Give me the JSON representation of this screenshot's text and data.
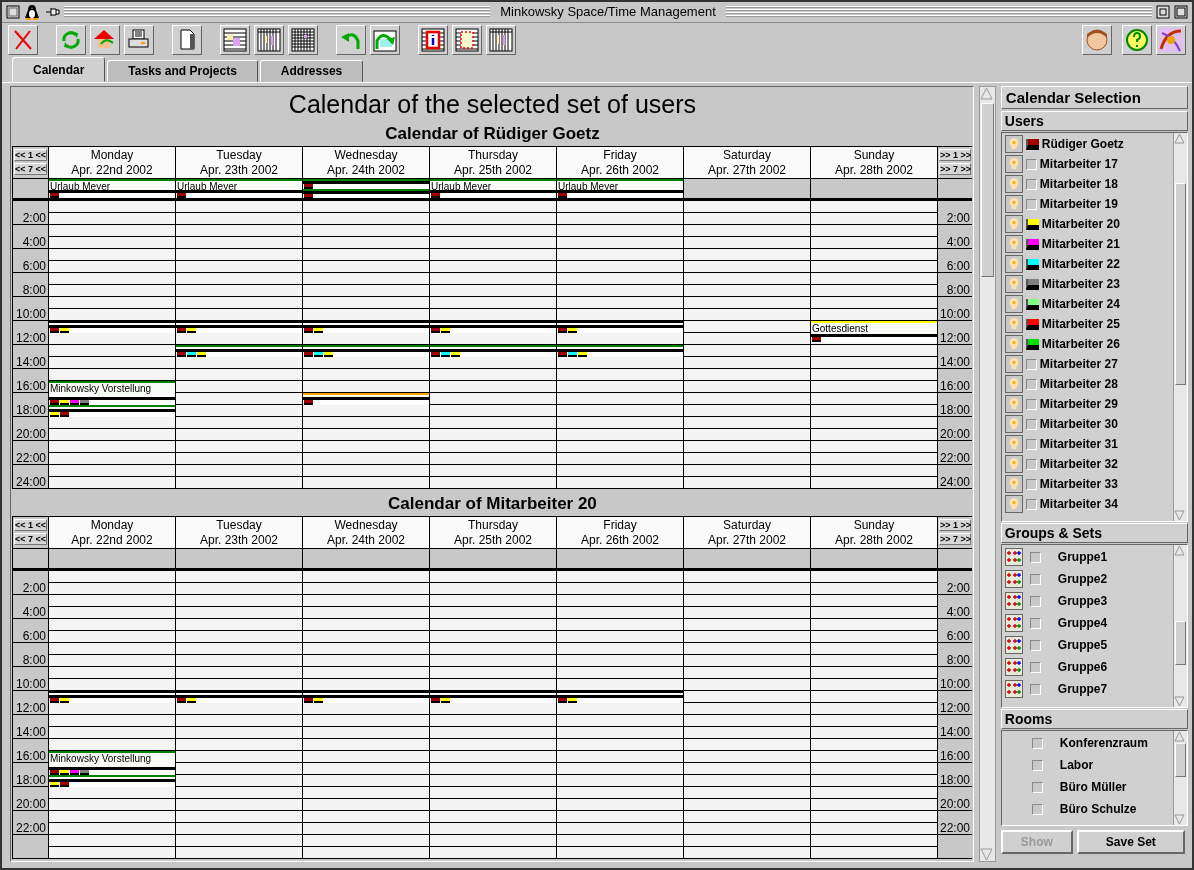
{
  "window": {
    "title": "Minkowsky Space/Time Management"
  },
  "tabs": [
    {
      "label": "Calendar",
      "selected": true
    },
    {
      "label": "Tasks and Projects",
      "selected": false
    },
    {
      "label": "Addresses",
      "selected": false
    }
  ],
  "calendar": {
    "heading": "Calendar of the selected set of users",
    "weeks": [
      {
        "title": "Calendar of Rüdiger Goetz",
        "nav_left": [
          "<< 1 <<",
          "<< 7 <<"
        ],
        "nav_right": [
          ">> 1 >>",
          ">> 7 >>"
        ],
        "times_left": [
          "2:00",
          "4:00",
          "6:00",
          "8:00",
          "10:00",
          "12:00",
          "14:00",
          "16:00",
          "18:00",
          "20:00",
          "22:00",
          "24:00"
        ],
        "times_right": [
          "2:00",
          "4:00",
          "6:00",
          "8:00",
          "10:00",
          "12:00",
          "14:00",
          "16:00",
          "18:00",
          "20:00",
          "22:00",
          "24:00"
        ],
        "days": [
          {
            "name": "Monday",
            "date": "Apr. 22nd 2002",
            "all_day": [
              {
                "title": "Urlaub Meyer",
                "color": "#008000",
                "marks": [
                  {
                    "color": "#a00000"
                  }
                ]
              }
            ],
            "slots": [
              {
                "kind": "gap"
              },
              {
                "kind": "gap"
              },
              {
                "kind": "gap"
              },
              {
                "kind": "gap"
              },
              {
                "kind": "gap"
              },
              {
                "kind": "gap"
              },
              {
                "kind": "gap"
              },
              {
                "kind": "gap"
              },
              {
                "kind": "gap"
              },
              {
                "kind": "gap"
              },
              {
                "kind": "hour",
                "color": "#000000",
                "marks": [
                  {
                    "color": "#a00000"
                  },
                  {
                    "color": "#ffff00"
                  }
                ]
              },
              {
                "kind": "gap"
              },
              {
                "kind": "gap"
              },
              {
                "kind": "gap"
              },
              {
                "kind": "gap"
              },
              {
                "kind": "two-hours",
                "title": "Minkowsky Vorstellung",
                "color": "#008000",
                "marks": [
                  {
                    "color": "#a00000"
                  },
                  {
                    "color": "#ffff00"
                  },
                  {
                    "color": "#ff00ff"
                  },
                  {
                    "color": "#808080"
                  }
                ]
              },
              {
                "kind": "hour",
                "color": "#008000",
                "marks": [
                  {
                    "color": "#ffff00"
                  },
                  {
                    "color": "#a00000"
                  }
                ]
              }
            ]
          },
          {
            "name": "Tuesday",
            "date": "Apr. 23th 2002",
            "all_day": [
              {
                "title": "Urlaub Meyer",
                "color": "#008000",
                "marks": [
                  {
                    "color": "#a00000"
                  }
                ]
              }
            ],
            "slots": [
              {
                "kind": "gap"
              },
              {
                "kind": "gap"
              },
              {
                "kind": "gap"
              },
              {
                "kind": "gap"
              },
              {
                "kind": "gap"
              },
              {
                "kind": "gap"
              },
              {
                "kind": "gap"
              },
              {
                "kind": "gap"
              },
              {
                "kind": "gap"
              },
              {
                "kind": "gap"
              },
              {
                "kind": "hour",
                "color": "#000000",
                "marks": [
                  {
                    "color": "#a00000"
                  },
                  {
                    "color": "#ffff00"
                  }
                ]
              },
              {
                "kind": "gap"
              },
              {
                "kind": "hour",
                "color": "#008000",
                "marks": [
                  {
                    "color": "#a00000"
                  },
                  {
                    "color": "#00ffff"
                  },
                  {
                    "color": "#ffff00"
                  }
                ]
              }
            ]
          },
          {
            "name": "Wednesday",
            "date": "Apr. 24th 2002",
            "all_day": [
              {
                "color": "#008000",
                "marks": [
                  {
                    "color": "#a00000"
                  }
                ]
              },
              {
                "color": "#008000",
                "marks": [
                  {
                    "color": "#a00000"
                  }
                ]
              }
            ],
            "slots": [
              {
                "kind": "gap"
              },
              {
                "kind": "gap"
              },
              {
                "kind": "gap"
              },
              {
                "kind": "gap"
              },
              {
                "kind": "gap"
              },
              {
                "kind": "gap"
              },
              {
                "kind": "gap"
              },
              {
                "kind": "gap"
              },
              {
                "kind": "gap"
              },
              {
                "kind": "gap"
              },
              {
                "kind": "hour",
                "color": "#000000",
                "marks": [
                  {
                    "color": "#a00000"
                  },
                  {
                    "color": "#ffff00"
                  }
                ]
              },
              {
                "kind": "gap"
              },
              {
                "kind": "hour",
                "color": "#008000",
                "marks": [
                  {
                    "color": "#a00000"
                  },
                  {
                    "color": "#00ffff"
                  },
                  {
                    "color": "#ffff00"
                  }
                ]
              },
              {
                "kind": "gap"
              },
              {
                "kind": "gap"
              },
              {
                "kind": "gap"
              },
              {
                "kind": "hour",
                "color": "#ffa500",
                "marks": [
                  {
                    "color": "#a00000"
                  }
                ]
              }
            ]
          },
          {
            "name": "Thursday",
            "date": "Apr. 25th 2002",
            "all_day": [
              {
                "title": "Urlaub Meyer",
                "color": "#008000",
                "marks": [
                  {
                    "color": "#a00000"
                  }
                ]
              }
            ],
            "slots": [
              {
                "kind": "gap"
              },
              {
                "kind": "gap"
              },
              {
                "kind": "gap"
              },
              {
                "kind": "gap"
              },
              {
                "kind": "gap"
              },
              {
                "kind": "gap"
              },
              {
                "kind": "gap"
              },
              {
                "kind": "gap"
              },
              {
                "kind": "gap"
              },
              {
                "kind": "gap"
              },
              {
                "kind": "hour",
                "color": "#000000",
                "marks": [
                  {
                    "color": "#a00000"
                  },
                  {
                    "color": "#ffff00"
                  }
                ]
              },
              {
                "kind": "gap"
              },
              {
                "kind": "hour",
                "color": "#008000",
                "marks": [
                  {
                    "color": "#a00000"
                  },
                  {
                    "color": "#00ffff"
                  },
                  {
                    "color": "#ffff00"
                  }
                ]
              }
            ]
          },
          {
            "name": "Friday",
            "date": "Apr. 26th 2002",
            "all_day": [
              {
                "title": "Urlaub Meyer",
                "color": "#008000",
                "marks": [
                  {
                    "color": "#a00000"
                  }
                ]
              }
            ],
            "slots": [
              {
                "kind": "gap"
              },
              {
                "kind": "gap"
              },
              {
                "kind": "gap"
              },
              {
                "kind": "gap"
              },
              {
                "kind": "gap"
              },
              {
                "kind": "gap"
              },
              {
                "kind": "gap"
              },
              {
                "kind": "gap"
              },
              {
                "kind": "gap"
              },
              {
                "kind": "gap"
              },
              {
                "kind": "hour",
                "color": "#000000",
                "marks": [
                  {
                    "color": "#a00000"
                  },
                  {
                    "color": "#ffff00"
                  }
                ]
              },
              {
                "kind": "gap"
              },
              {
                "kind": "hour",
                "color": "#008000",
                "marks": [
                  {
                    "color": "#a00000"
                  },
                  {
                    "color": "#00ffff"
                  },
                  {
                    "color": "#ffff00"
                  }
                ]
              }
            ]
          },
          {
            "name": "Saturday",
            "date": "Apr. 27th 2002"
          },
          {
            "name": "Sunday",
            "date": "Apr. 28th 2002",
            "slots": [
              {
                "kind": "gap"
              },
              {
                "kind": "gap"
              },
              {
                "kind": "gap"
              },
              {
                "kind": "gap"
              },
              {
                "kind": "gap"
              },
              {
                "kind": "gap"
              },
              {
                "kind": "gap"
              },
              {
                "kind": "gap"
              },
              {
                "kind": "gap"
              },
              {
                "kind": "gap"
              },
              {
                "kind": "hour-half",
                "title": "Gottesdienst",
                "color": "#ffff00",
                "marks": [
                  {
                    "color": "#a00000"
                  }
                ]
              }
            ]
          }
        ]
      },
      {
        "title": "Calendar of Mitarbeiter 20",
        "nav_left": [
          "<< 1 <<",
          "<< 7 <<"
        ],
        "nav_right": [
          ">> 1 >>",
          ">> 7 >>"
        ],
        "times_left": [
          "2:00",
          "4:00",
          "6:00",
          "8:00",
          "10:00",
          "12:00",
          "14:00",
          "16:00",
          "18:00",
          "20:00",
          "22:00"
        ],
        "times_right": [
          "2:00",
          "4:00",
          "6:00",
          "8:00",
          "10:00",
          "12:00",
          "14:00",
          "16:00",
          "18:00",
          "20:00",
          "22:00"
        ],
        "days": [
          {
            "name": "Monday",
            "date": "Apr. 22nd 2002",
            "slots": [
              {
                "kind": "gap"
              },
              {
                "kind": "gap"
              },
              {
                "kind": "gap"
              },
              {
                "kind": "gap"
              },
              {
                "kind": "gap"
              },
              {
                "kind": "gap"
              },
              {
                "kind": "gap"
              },
              {
                "kind": "gap"
              },
              {
                "kind": "gap"
              },
              {
                "kind": "gap"
              },
              {
                "kind": "hour",
                "color": "#000000",
                "marks": [
                  {
                    "color": "#a00000"
                  },
                  {
                    "color": "#ffff00"
                  }
                ]
              },
              {
                "kind": "gap"
              },
              {
                "kind": "gap"
              },
              {
                "kind": "gap"
              },
              {
                "kind": "gap"
              },
              {
                "kind": "two-hours",
                "title": "Minkowsky Vorstellung",
                "color": "#008000",
                "marks": [
                  {
                    "color": "#a00000"
                  },
                  {
                    "color": "#ffff00"
                  },
                  {
                    "color": "#ff00ff"
                  },
                  {
                    "color": "#808080"
                  }
                ]
              },
              {
                "kind": "hour",
                "color": "#008000",
                "marks": [
                  {
                    "color": "#ffff00"
                  },
                  {
                    "color": "#a00000"
                  }
                ]
              }
            ]
          },
          {
            "name": "Tuesday",
            "date": "Apr. 23th 2002",
            "slots": [
              {
                "kind": "gap"
              },
              {
                "kind": "gap"
              },
              {
                "kind": "gap"
              },
              {
                "kind": "gap"
              },
              {
                "kind": "gap"
              },
              {
                "kind": "gap"
              },
              {
                "kind": "gap"
              },
              {
                "kind": "gap"
              },
              {
                "kind": "gap"
              },
              {
                "kind": "gap"
              },
              {
                "kind": "hour",
                "color": "#000000",
                "marks": [
                  {
                    "color": "#a00000"
                  },
                  {
                    "color": "#ffff00"
                  }
                ]
              }
            ]
          },
          {
            "name": "Wednesday",
            "date": "Apr. 24th 2002",
            "slots": [
              {
                "kind": "gap"
              },
              {
                "kind": "gap"
              },
              {
                "kind": "gap"
              },
              {
                "kind": "gap"
              },
              {
                "kind": "gap"
              },
              {
                "kind": "gap"
              },
              {
                "kind": "gap"
              },
              {
                "kind": "gap"
              },
              {
                "kind": "gap"
              },
              {
                "kind": "gap"
              },
              {
                "kind": "hour",
                "color": "#000000",
                "marks": [
                  {
                    "color": "#a00000"
                  },
                  {
                    "color": "#ffff00"
                  }
                ]
              }
            ]
          },
          {
            "name": "Thursday",
            "date": "Apr. 25th 2002",
            "slots": [
              {
                "kind": "gap"
              },
              {
                "kind": "gap"
              },
              {
                "kind": "gap"
              },
              {
                "kind": "gap"
              },
              {
                "kind": "gap"
              },
              {
                "kind": "gap"
              },
              {
                "kind": "gap"
              },
              {
                "kind": "gap"
              },
              {
                "kind": "gap"
              },
              {
                "kind": "gap"
              },
              {
                "kind": "hour",
                "color": "#000000",
                "marks": [
                  {
                    "color": "#a00000"
                  },
                  {
                    "color": "#ffff00"
                  }
                ]
              }
            ]
          },
          {
            "name": "Friday",
            "date": "Apr. 26th 2002",
            "slots": [
              {
                "kind": "gap"
              },
              {
                "kind": "gap"
              },
              {
                "kind": "gap"
              },
              {
                "kind": "gap"
              },
              {
                "kind": "gap"
              },
              {
                "kind": "gap"
              },
              {
                "kind": "gap"
              },
              {
                "kind": "gap"
              },
              {
                "kind": "gap"
              },
              {
                "kind": "gap"
              },
              {
                "kind": "hour",
                "color": "#000000",
                "marks": [
                  {
                    "color": "#a00000"
                  },
                  {
                    "color": "#ffff00"
                  }
                ]
              }
            ]
          },
          {
            "name": "Saturday",
            "date": "Apr. 27th 2002"
          },
          {
            "name": "Sunday",
            "date": "Apr. 28th 2002"
          }
        ]
      }
    ]
  },
  "selection": {
    "title": "Calendar Selection",
    "users": {
      "title": "Users",
      "items": [
        {
          "name": "Rüdiger Goetz",
          "checked": true,
          "color": "#a00000"
        },
        {
          "name": "Mitarbeiter 17",
          "checked": false
        },
        {
          "name": "Mitarbeiter 18",
          "checked": false
        },
        {
          "name": "Mitarbeiter 19",
          "checked": false
        },
        {
          "name": "Mitarbeiter 20",
          "checked": true,
          "color": "#ffff00"
        },
        {
          "name": "Mitarbeiter 21",
          "checked": true,
          "color": "#ff00ff"
        },
        {
          "name": "Mitarbeiter 22",
          "checked": true,
          "color": "#00ffff"
        },
        {
          "name": "Mitarbeiter 23",
          "checked": true,
          "color": "#808080"
        },
        {
          "name": "Mitarbeiter 24",
          "checked": true,
          "color": "#80ff80"
        },
        {
          "name": "Mitarbeiter 25",
          "checked": true,
          "color": "#ff0000"
        },
        {
          "name": "Mitarbeiter 26",
          "checked": true,
          "color": "#00e000"
        },
        {
          "name": "Mitarbeiter 27",
          "checked": false
        },
        {
          "name": "Mitarbeiter 28",
          "checked": false
        },
        {
          "name": "Mitarbeiter 29",
          "checked": false
        },
        {
          "name": "Mitarbeiter 30",
          "checked": false
        },
        {
          "name": "Mitarbeiter 31",
          "checked": false
        },
        {
          "name": "Mitarbeiter 32",
          "checked": false
        },
        {
          "name": "Mitarbeiter 33",
          "checked": false
        },
        {
          "name": "Mitarbeiter 34",
          "checked": false
        }
      ]
    },
    "groups": {
      "title": "Groups & Sets",
      "items": [
        {
          "name": "Gruppe1",
          "checked": false
        },
        {
          "name": "Gruppe2",
          "checked": false
        },
        {
          "name": "Gruppe3",
          "checked": false
        },
        {
          "name": "Gruppe4",
          "checked": false
        },
        {
          "name": "Gruppe5",
          "checked": false
        },
        {
          "name": "Gruppe6",
          "checked": false
        },
        {
          "name": "Gruppe7",
          "checked": false
        }
      ]
    },
    "rooms": {
      "title": "Rooms",
      "items": [
        {
          "name": "Konferenzraum",
          "checked": false
        },
        {
          "name": "Labor",
          "checked": false
        },
        {
          "name": "Büro Müller",
          "checked": false
        },
        {
          "name": "Büro Schulze",
          "checked": false
        }
      ]
    },
    "buttons": [
      {
        "label": "Show",
        "disabled": true
      },
      {
        "label": "Save Set",
        "disabled": false
      }
    ]
  }
}
